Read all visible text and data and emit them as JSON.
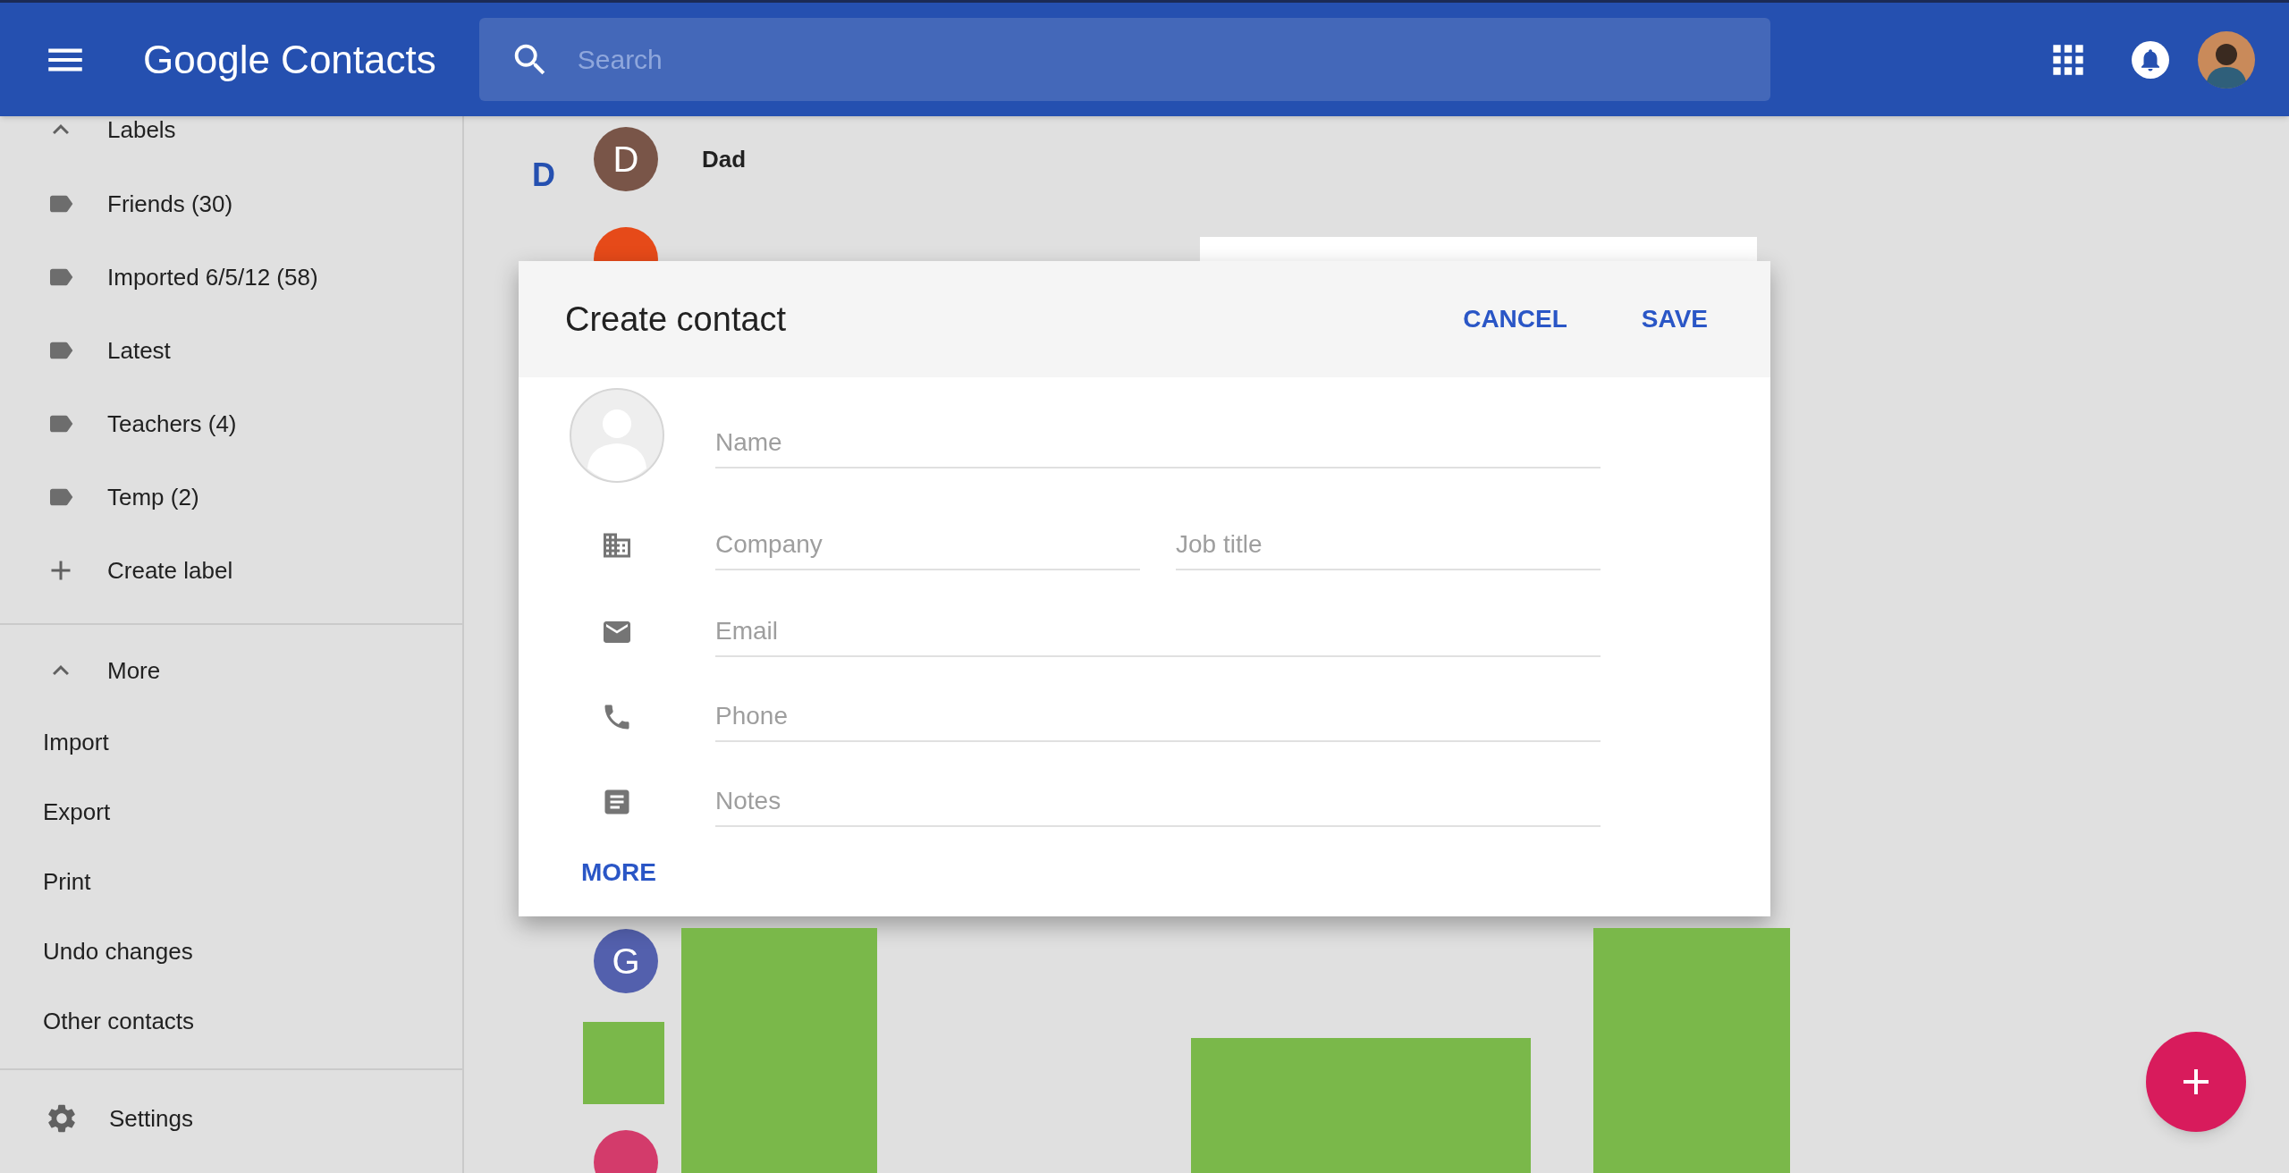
{
  "header": {
    "title": "Google Contacts",
    "search": {
      "placeholder": "Search"
    }
  },
  "sidebar": {
    "labels_section": {
      "title": "Labels",
      "expanded": true,
      "items": [
        "Friends (30)",
        "Imported 6/5/12 (58)",
        "Latest",
        "Teachers (4)",
        "Temp (2)"
      ],
      "create": "Create label"
    },
    "more_section": {
      "title": "More",
      "expanded": true,
      "items": [
        "Import",
        "Export",
        "Print",
        "Undo changes",
        "Other contacts"
      ]
    },
    "settings": "Settings"
  },
  "contacts": {
    "letter": "D",
    "rows": [
      {
        "initial": "D",
        "name": "Dad",
        "color": "#795548"
      },
      {
        "color": "#e64a19"
      },
      {
        "initial": "G",
        "color": "#5360ad"
      },
      {
        "color": "#d33b6b"
      }
    ]
  },
  "dialog": {
    "title": "Create contact",
    "actions": [
      "CANCEL",
      "SAVE"
    ],
    "rows": [
      {
        "kind": "name",
        "fields": [
          {
            "placeholder": "Name"
          }
        ]
      },
      {
        "kind": "company",
        "fields": [
          {
            "placeholder": "Company"
          },
          {
            "placeholder": "Job title"
          }
        ]
      },
      {
        "kind": "email",
        "fields": [
          {
            "placeholder": "Email"
          }
        ]
      },
      {
        "kind": "phone",
        "fields": [
          {
            "placeholder": "Phone"
          }
        ]
      },
      {
        "kind": "notes",
        "fields": [
          {
            "placeholder": "Notes"
          }
        ]
      }
    ],
    "more": "MORE"
  }
}
